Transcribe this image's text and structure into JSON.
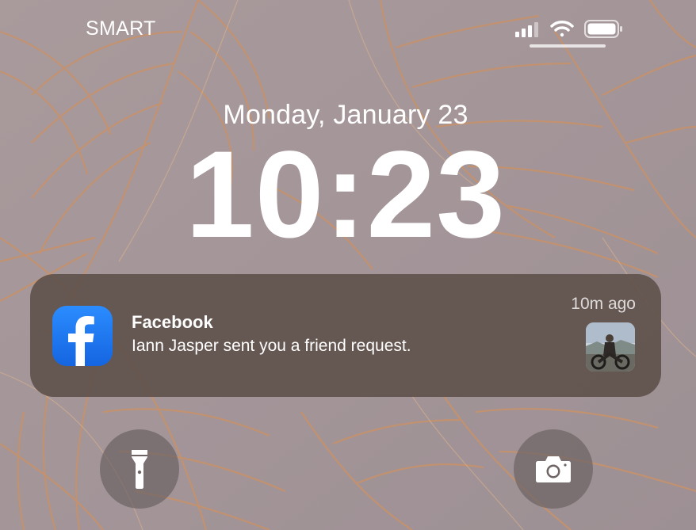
{
  "status_bar": {
    "carrier": "SMART",
    "icons": [
      "cellular-signal-icon",
      "wifi-icon",
      "battery-icon"
    ]
  },
  "lock_screen": {
    "date": "Monday, January 23",
    "time": "10:23"
  },
  "notification": {
    "app_name": "Facebook",
    "app_icon": "facebook-icon",
    "message": "Iann Jasper sent you a friend request.",
    "timestamp": "10m ago",
    "thumbnail": "profile-photo-thumbnail"
  },
  "quick_actions": {
    "flashlight_icon": "flashlight-icon",
    "camera_icon": "camera-icon"
  },
  "colors": {
    "wallpaper_base": "#a39598",
    "leaf_line": "#c8926a",
    "facebook_blue": "#1877f2",
    "notification_bg": "#5c4e48"
  }
}
